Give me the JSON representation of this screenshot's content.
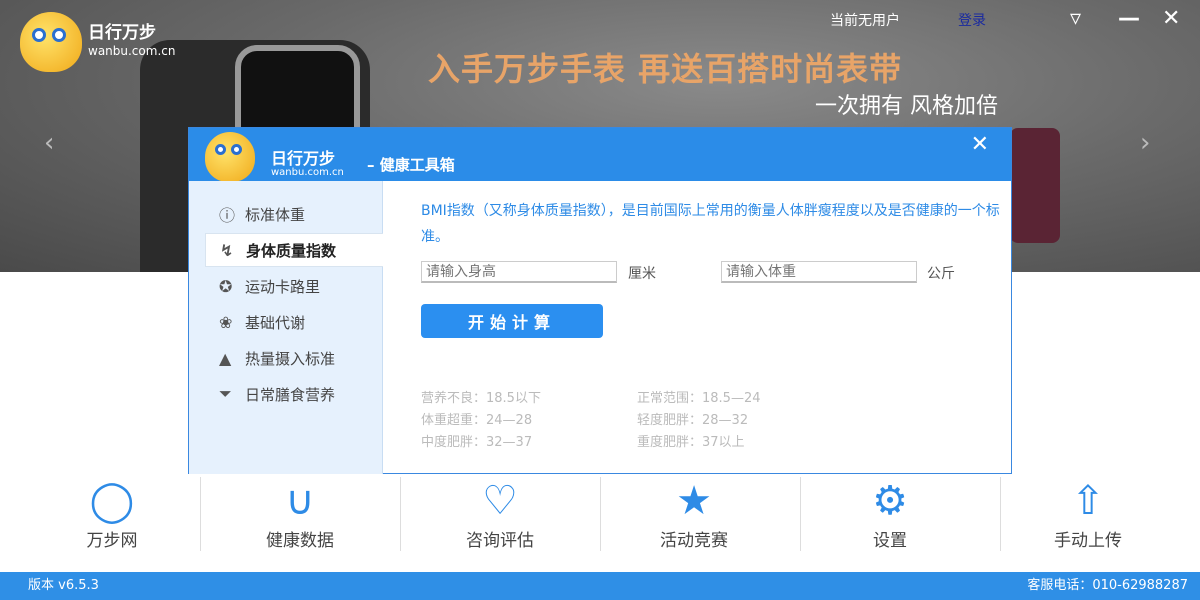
{
  "app": {
    "logo_cn": "日行万步",
    "logo_domain": "wanbu.com.cn"
  },
  "header": {
    "user_status": "当前无用户",
    "login": "登录",
    "promo_title": "入手万步手表 再送百搭时尚表带",
    "promo_sub": "一次拥有 风格加倍"
  },
  "dialog": {
    "title": "– 健康工具箱",
    "sidebar": [
      {
        "label": "标准体重",
        "icon": "info-icon"
      },
      {
        "label": "身体质量指数",
        "icon": "line-chart-icon",
        "active": true
      },
      {
        "label": "运动卡路里",
        "icon": "runner-icon"
      },
      {
        "label": "基础代谢",
        "icon": "sprout-icon"
      },
      {
        "label": "热量摄入标准",
        "icon": "food-icon"
      },
      {
        "label": "日常膳食营养",
        "icon": "dish-icon"
      }
    ],
    "description": "BMI指数（又称身体质量指数），是目前国际上常用的衡量人体胖瘦程度以及是否健康的一个标准。",
    "height_placeholder": "请输入身高",
    "height_unit": "厘米",
    "weight_placeholder": "请输入体重",
    "weight_unit": "公斤",
    "calc_button": "开始计算",
    "ranges": [
      "营养不良：18.5以下",
      "正常范围：18.5—24",
      "体重超重：24—28",
      "轻度肥胖：28—32",
      "中度肥胖：32—37",
      "重度肥胖：37以上"
    ]
  },
  "nav": [
    {
      "label": "万步网",
      "icon": "pear-icon"
    },
    {
      "label": "健康数据",
      "icon": "bar-chart-icon"
    },
    {
      "label": "咨询评估",
      "icon": "heart-icon"
    },
    {
      "label": "活动竞赛",
      "icon": "trophy-icon"
    },
    {
      "label": "设置",
      "icon": "gear-icon"
    },
    {
      "label": "手动上传",
      "icon": "cloud-upload-icon"
    }
  ],
  "footer": {
    "version": "版本 v6.5.3",
    "hotline": "客服电话：010-62988287"
  },
  "colors": {
    "accent": "#2b8ce8",
    "footer": "#2f8fe6"
  }
}
